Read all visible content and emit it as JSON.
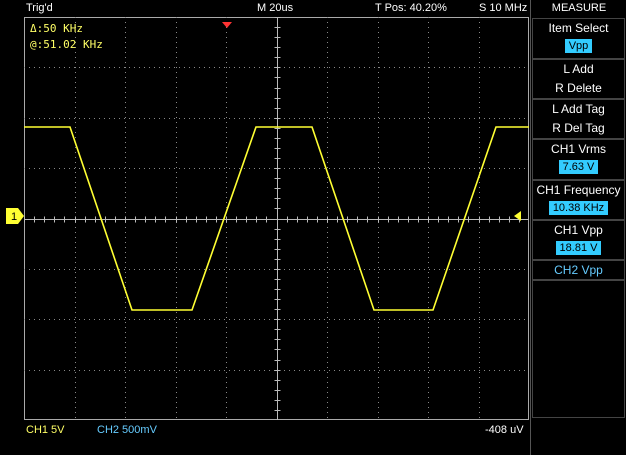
{
  "status": {
    "trig": "Trig'd",
    "timebase": "M 20us",
    "tpos": "T Pos: 40.20%",
    "sample_rate": "S 10 MHz"
  },
  "cursor_readouts": {
    "delta": "Δ:50 KHz",
    "at": "@:51.02 KHz"
  },
  "channel_marker": "1",
  "bottom": {
    "ch1_scale": "CH1  5V",
    "ch2_scale": "CH2  500mV",
    "offset": "-408 uV"
  },
  "menu": {
    "title": "MEASURE",
    "item_select_label": "Item Select",
    "item_select_value": "Vpp",
    "l_add": "L Add",
    "r_delete": "R Delete",
    "l_add_tag": "L Add Tag",
    "r_del_tag": "R Del Tag",
    "ch1_vrms_label": "CH1 Vrms",
    "ch1_vrms_value": "7.63 V",
    "ch1_freq_label": "CH1 Frequency",
    "ch1_freq_value": "10.38 KHz",
    "ch1_vpp_label": "CH1 Vpp",
    "ch1_vpp_value": "18.81 V",
    "ch2_vpp_label": "CH2 Vpp"
  },
  "colors": {
    "ch1": "#ffff33",
    "ch2": "#66ccff",
    "grid": "#aaaaaa",
    "trigger_marker": "#ff3333",
    "value_bg": "#33ccff"
  },
  "icons": {
    "trigger_position": "down-triangle-icon",
    "trigger_level": "left-triangle-icon",
    "channel_ground": "ch1-ground-marker-icon"
  }
}
